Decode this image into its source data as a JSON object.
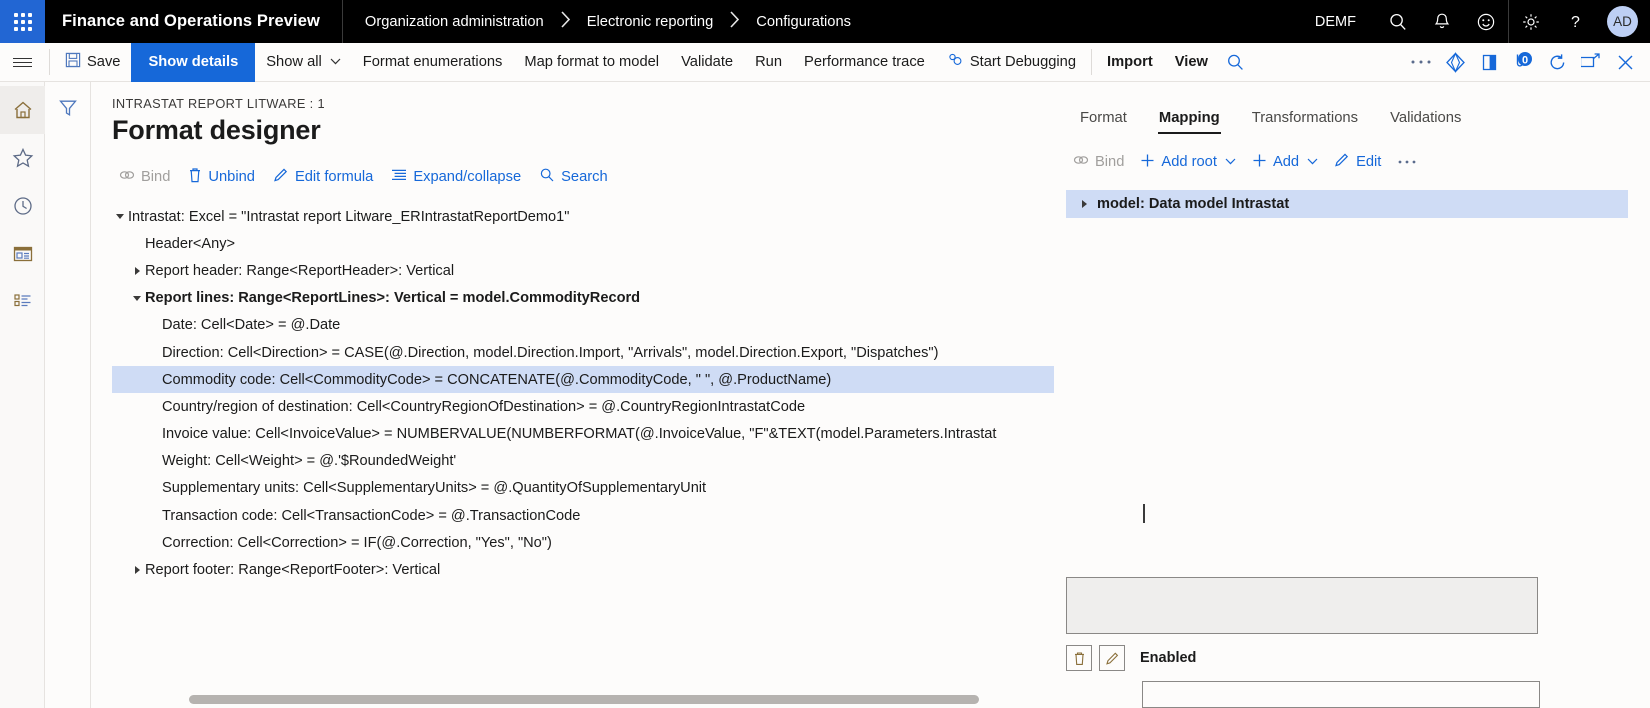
{
  "topbar": {
    "waffle_icon": "app-launcher-icon",
    "app_title": "Finance and Operations Preview",
    "breadcrumb": [
      "Organization administration",
      "Electronic reporting",
      "Configurations"
    ],
    "breadcrumb_separator": "›",
    "company": "DEMF",
    "icons": [
      "search-icon",
      "notifications-bell-icon",
      "feedback-smiley-icon",
      "settings-gear-icon",
      "help-question-icon"
    ],
    "avatar_initials": "AD"
  },
  "toolbar": {
    "hamburger": "nav-menu-icon",
    "save_label": "Save",
    "show_details_label": "Show details",
    "show_all_label": "Show all",
    "format_enumerations_label": "Format enumerations",
    "map_format_to_model_label": "Map format to model",
    "validate_label": "Validate",
    "run_label": "Run",
    "performance_trace_label": "Performance trace",
    "start_debugging_label": "Start Debugging",
    "import_label": "Import",
    "view_label": "View",
    "right_icons": [
      "search-icon",
      "overflow-ellipsis-icon",
      "share-icon",
      "open-in-new-icon",
      "attachments-icon",
      "refresh-icon",
      "popout-icon",
      "close-icon"
    ],
    "attachment_count": "0"
  },
  "left_rail": {
    "items": [
      "home-icon",
      "favorites-star-icon",
      "recent-clock-icon",
      "workspaces-icon",
      "modules-list-icon"
    ]
  },
  "filter_rail": {
    "icon": "filter-funnel-icon"
  },
  "designer": {
    "eyebrow": "INTRASTAT REPORT LITWARE : 1",
    "title": "Format designer",
    "actions": [
      {
        "label": "Bind",
        "icon": "link-bind-icon",
        "disabled": true
      },
      {
        "label": "Unbind",
        "icon": "trash-unbind-icon",
        "disabled": false
      },
      {
        "label": "Edit formula",
        "icon": "pencil-edit-icon",
        "disabled": false
      },
      {
        "label": "Expand/collapse",
        "icon": "expand-collapse-icon",
        "disabled": false
      },
      {
        "label": "Search",
        "icon": "search-icon",
        "disabled": false
      }
    ],
    "tree": [
      {
        "label": "Intrastat: Excel = \"Intrastat report Litware_ERIntrastatReportDemo1\"",
        "indent": 0,
        "twist": "down",
        "bold": false,
        "selected": false
      },
      {
        "label": "Header<Any>",
        "indent": 1,
        "twist": "none",
        "bold": false,
        "selected": false
      },
      {
        "label": "Report header: Range<ReportHeader>: Vertical",
        "indent": 1,
        "twist": "right",
        "bold": false,
        "selected": false
      },
      {
        "label": "Report lines: Range<ReportLines>: Vertical = model.CommodityRecord",
        "indent": 1,
        "twist": "down",
        "bold": true,
        "selected": false
      },
      {
        "label": "Date: Cell<Date> = @.Date",
        "indent": 2,
        "twist": "none",
        "bold": false,
        "selected": false
      },
      {
        "label": "Direction: Cell<Direction> = CASE(@.Direction, model.Direction.Import, \"Arrivals\", model.Direction.Export, \"Dispatches\")",
        "indent": 2,
        "twist": "none",
        "bold": false,
        "selected": false
      },
      {
        "label": "Commodity code: Cell<CommodityCode> = CONCATENATE(@.CommodityCode, \" \", @.ProductName)",
        "indent": 2,
        "twist": "none",
        "bold": false,
        "selected": true
      },
      {
        "label": "Country/region of destination: Cell<CountryRegionOfDestination> = @.CountryRegionIntrastatCode",
        "indent": 2,
        "twist": "none",
        "bold": false,
        "selected": false
      },
      {
        "label": "Invoice value: Cell<InvoiceValue> = NUMBERVALUE(NUMBERFORMAT(@.InvoiceValue, \"F\"&TEXT(model.Parameters.Intrastat",
        "indent": 2,
        "twist": "none",
        "bold": false,
        "selected": false
      },
      {
        "label": "Weight: Cell<Weight> = @.'$RoundedWeight'",
        "indent": 2,
        "twist": "none",
        "bold": false,
        "selected": false
      },
      {
        "label": "Supplementary units: Cell<SupplementaryUnits> = @.QuantityOfSupplementaryUnit",
        "indent": 2,
        "twist": "none",
        "bold": false,
        "selected": false
      },
      {
        "label": "Transaction code: Cell<TransactionCode> = @.TransactionCode",
        "indent": 2,
        "twist": "none",
        "bold": false,
        "selected": false
      },
      {
        "label": "Correction: Cell<Correction> = IF(@.Correction, \"Yes\", \"No\")",
        "indent": 2,
        "twist": "none",
        "bold": false,
        "selected": false
      },
      {
        "label": "Report footer: Range<ReportFooter>: Vertical",
        "indent": 1,
        "twist": "right",
        "bold": false,
        "selected": false
      }
    ]
  },
  "right_pane": {
    "tabs": [
      {
        "label": "Format",
        "active": false
      },
      {
        "label": "Mapping",
        "active": true
      },
      {
        "label": "Transformations",
        "active": false
      },
      {
        "label": "Validations",
        "active": false
      }
    ],
    "actions": [
      {
        "label": "Bind",
        "icon": "link-bind-icon",
        "disabled": true,
        "caret": false
      },
      {
        "label": "Add root",
        "icon": "plus-icon",
        "disabled": false,
        "caret": true
      },
      {
        "label": "Add",
        "icon": "plus-icon",
        "disabled": false,
        "caret": true
      },
      {
        "label": "Edit",
        "icon": "pencil-edit-icon",
        "disabled": false,
        "caret": false
      },
      {
        "label": "⋯",
        "icon": "overflow-ellipsis-icon",
        "disabled": false,
        "caret": false
      }
    ],
    "tree": [
      {
        "label": "model: Data model Intrastat",
        "twist": "right",
        "selected": true
      }
    ],
    "formula_value": "",
    "delete_icon": "trash-delete-icon",
    "edit_icon": "pencil-edit-icon",
    "enabled_label": "Enabled",
    "enabled_value": ""
  },
  "colors": {
    "accent": "#1668d9",
    "topbar_bg": "#000000",
    "selection": "#cfdcf5",
    "page_bg": "#fdfcfb"
  }
}
